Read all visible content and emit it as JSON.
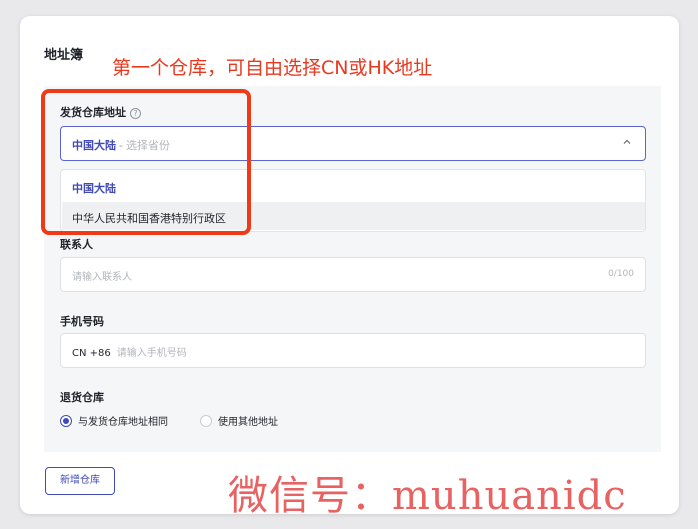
{
  "card": {
    "title": "地址簿"
  },
  "annotation": "第一个仓库，可自由选择CN或HK地址",
  "warehouse": {
    "label": "发货仓库地址",
    "help_icon": "?",
    "selected_region": "中国大陆",
    "separator": "-",
    "placeholder": "选择省份",
    "options": [
      "中国大陆",
      "中华人民共和国香港特别行政区"
    ]
  },
  "contact": {
    "label": "联系人",
    "placeholder": "请输入联系人",
    "counter": "0/100"
  },
  "phone": {
    "label": "手机号码",
    "prefix": "CN +86",
    "placeholder": "请输入手机号码"
  },
  "return_warehouse": {
    "label": "退货仓库",
    "options": [
      "与发货仓库地址相同",
      "使用其他地址"
    ],
    "selected_index": 0
  },
  "add_button": "新增仓库",
  "watermark": "微信号：muhuanidc",
  "colors": {
    "accent": "#3f4ab8",
    "annotation": "#e8391f",
    "frame": "#f03a17"
  }
}
